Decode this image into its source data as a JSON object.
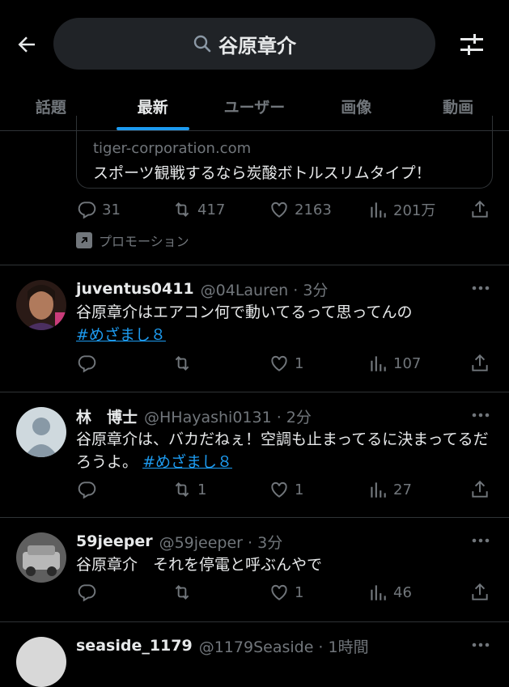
{
  "search": {
    "query": "谷原章介"
  },
  "tabs": [
    {
      "label": "話題",
      "active": false
    },
    {
      "label": "最新",
      "active": true
    },
    {
      "label": "ユーザー",
      "active": false
    },
    {
      "label": "画像",
      "active": false
    },
    {
      "label": "動画",
      "active": false
    }
  ],
  "promo": {
    "domain": "tiger-corporation.com",
    "headline": "スポーツ観戦するなら炭酸ボトルスリムタイプ！",
    "replies": "31",
    "retweets": "417",
    "likes": "2163",
    "views": "201万",
    "label": "プロモーション"
  },
  "tweets": [
    {
      "name": "juventus0411",
      "handle": "@04Lauren · 3分",
      "text": "谷原章介はエアコン何で動いてるって思ってんの",
      "hashtag": "#めざまし８",
      "replies": "",
      "retweets": "",
      "likes": "1",
      "views": "107"
    },
    {
      "name": "林　博士",
      "handle": "@HHayashi0131 · 2分",
      "text": "谷原章介は、バカだねぇ！空調も止まってるに決まってるだろうよ。",
      "hashtag": "#めざまし８",
      "replies": "",
      "retweets": "1",
      "likes": "1",
      "views": "27"
    },
    {
      "name": "59jeeper",
      "handle": "@59jeeper · 3分",
      "text": "谷原章介　それを停電と呼ぶんやで",
      "hashtag": "",
      "replies": "",
      "retweets": "",
      "likes": "1",
      "views": "46"
    },
    {
      "name": "seaside_1179",
      "handle": "@1179Seaside · 1時間",
      "text": "",
      "hashtag": "",
      "replies": "",
      "retweets": "",
      "likes": "",
      "views": ""
    }
  ],
  "colors": {
    "accent": "#1d9bf0",
    "muted": "#71767b",
    "background": "#000000",
    "divider": "#2f3336"
  }
}
